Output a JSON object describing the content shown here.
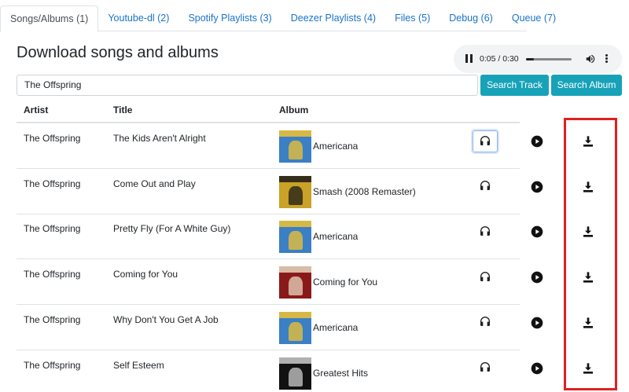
{
  "tabs": [
    {
      "label": "Songs/Albums (1)",
      "active": true
    },
    {
      "label": "Youtube-dl (2)"
    },
    {
      "label": "Spotify Playlists (3)"
    },
    {
      "label": "Deezer Playlists (4)"
    },
    {
      "label": "Files (5)"
    },
    {
      "label": "Debug (6)"
    },
    {
      "label": "Queue (7)"
    }
  ],
  "page_title": "Download songs and albums",
  "player": {
    "time": "0:05 / 0:30",
    "progress": 0.17
  },
  "search": {
    "value": "The Offspring",
    "track_button": "Search Track",
    "album_button": "Search Album"
  },
  "table": {
    "headers": {
      "artist": "Artist",
      "title": "Title",
      "album": "Album"
    },
    "rows": [
      {
        "artist": "The Offspring",
        "title": "The Kids Aren't Alright",
        "album": "Americana"
      },
      {
        "artist": "The Offspring",
        "title": "Come Out and Play",
        "album": "Smash (2008 Remaster)"
      },
      {
        "artist": "The Offspring",
        "title": "Pretty Fly (For A White Guy)",
        "album": "Americana"
      },
      {
        "artist": "The Offspring",
        "title": "Coming for You",
        "album": "Coming for You"
      },
      {
        "artist": "The Offspring",
        "title": "Why Don't You Get A Job",
        "album": "Americana"
      },
      {
        "artist": "The Offspring",
        "title": "Self Esteem",
        "album": "Greatest Hits"
      }
    ]
  },
  "icons": {
    "listen": "headphones-icon",
    "play": "play-circle-icon",
    "download": "download-icon"
  },
  "colors": {
    "accent": "#17a2b8",
    "link": "#1a73c8",
    "highlight": "#e02020"
  }
}
